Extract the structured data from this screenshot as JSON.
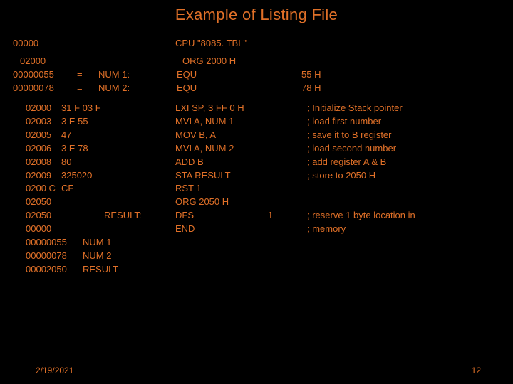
{
  "title": "Example of Listing File",
  "line1": {
    "addr": "00000",
    "op": "CPU \"8085. TBL\""
  },
  "equ": {
    "org_addr": "02000",
    "org_op": "ORG 2000 H",
    "l1": {
      "addr": "00000055",
      "eq": "=",
      "sym": "NUM 1:",
      "op": "EQU",
      "arg": "55 H"
    },
    "l2": {
      "addr": "00000078",
      "eq": "=",
      "sym": "NUM 2:",
      "op": "EQU",
      "arg": "78 H"
    }
  },
  "code": [
    {
      "addr": "02000",
      "hex": "31 F 03 F",
      "op": "LXI SP, 3 FF 0 H",
      "arg": "",
      "cmt": "; Initialize Stack pointer"
    },
    {
      "addr": "02003",
      "hex": "3 E 55",
      "op": "MVI A, NUM 1",
      "arg": "",
      "cmt": "; load first number"
    },
    {
      "addr": "02005",
      "hex": "47",
      "op": "MOV B, A",
      "arg": "",
      "cmt": "; save it to B register"
    },
    {
      "addr": "02006",
      "hex": "3 E 78",
      "op": "MVI A, NUM 2",
      "arg": "",
      "cmt": "; load second number"
    },
    {
      "addr": "02008",
      "hex": "80",
      "op": "ADD B",
      "arg": "",
      "cmt": "; add register A & B"
    },
    {
      "addr": "02009",
      "hex": "325020",
      "op": "STA RESULT",
      "arg": "",
      "cmt": "; store to 2050 H"
    },
    {
      "addr": "0200 C",
      "hex": "CF",
      "op": "RST 1",
      "arg": "",
      "cmt": ""
    },
    {
      "addr": "02050",
      "hex": "",
      "op": "ORG 2050 H",
      "arg": "",
      "cmt": ""
    },
    {
      "addr": "02050",
      "hex": "",
      "sym": "RESULT:",
      "op": "DFS",
      "arg": "1",
      "cmt": "; reserve 1 byte location in"
    },
    {
      "addr": "00000",
      "hex": "",
      "op": "END",
      "arg": "",
      "cmt": "; memory"
    }
  ],
  "symtab": [
    {
      "addr": "00000055",
      "name": "NUM 1"
    },
    {
      "addr": "00000078",
      "name": "NUM 2"
    },
    {
      "addr": "00002050",
      "name": "RESULT"
    }
  ],
  "footer": {
    "date": "2/19/2021",
    "page": "12"
  }
}
